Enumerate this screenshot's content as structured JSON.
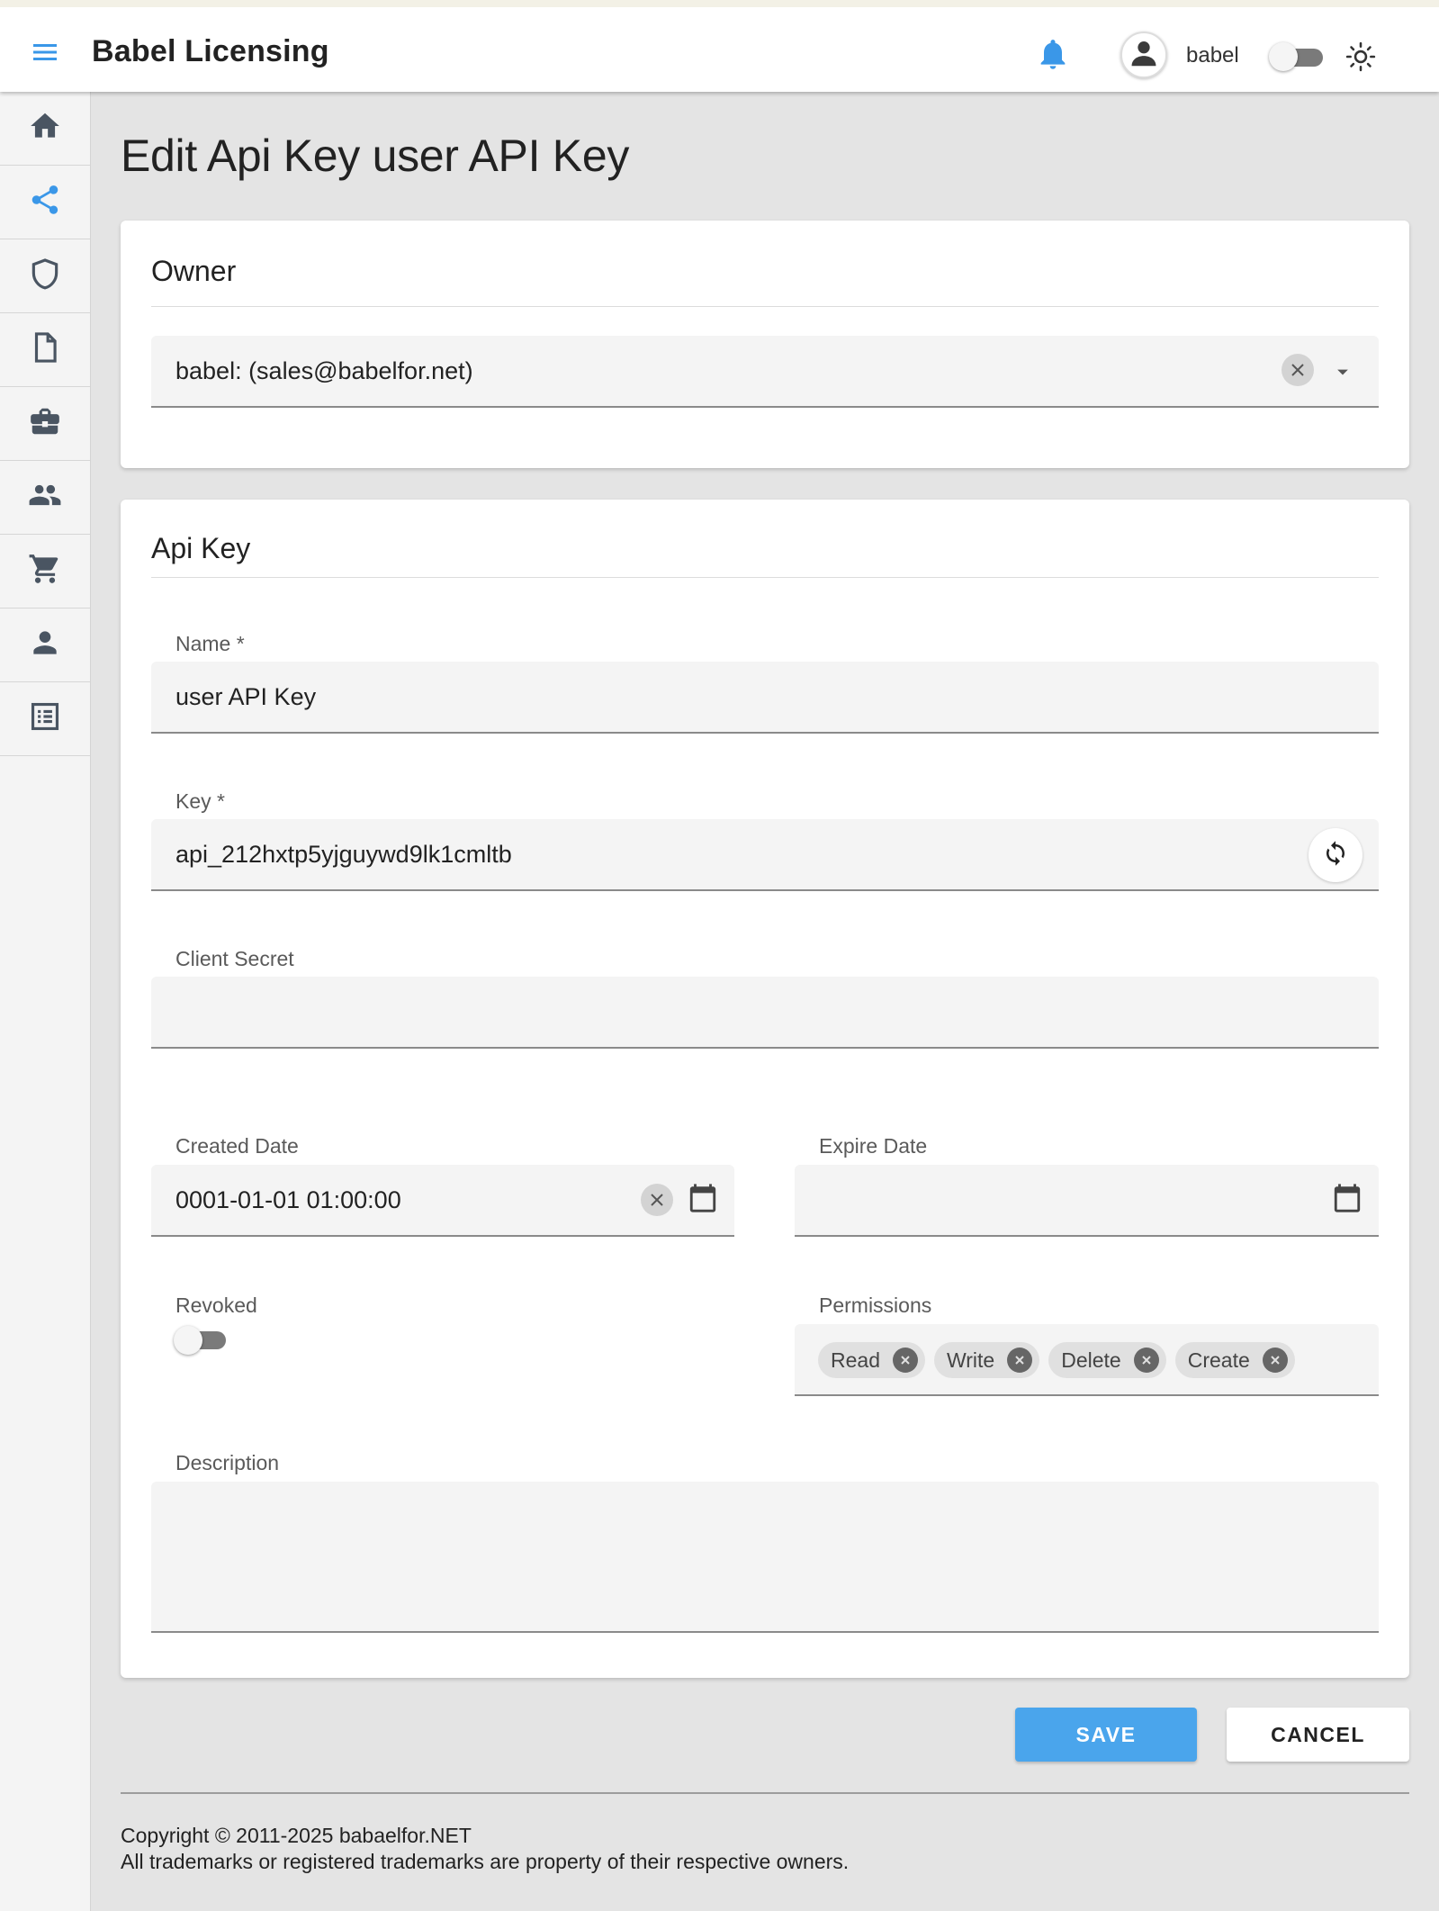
{
  "header": {
    "title": "Babel Licensing",
    "username": "babel",
    "icons": {
      "menu": "menu-icon",
      "notifications": "bell-icon",
      "user": "account-circle-icon",
      "theme": "sun-icon"
    },
    "accent_color": "#3a97e8"
  },
  "sidebar": {
    "items": [
      {
        "icon": "home-icon",
        "active": false
      },
      {
        "icon": "share-icon",
        "active": true
      },
      {
        "icon": "shield-icon",
        "active": false
      },
      {
        "icon": "document-icon",
        "active": false
      },
      {
        "icon": "briefcase-icon",
        "active": false
      },
      {
        "icon": "group-icon",
        "active": false
      },
      {
        "icon": "cart-icon",
        "active": false
      },
      {
        "icon": "person-icon",
        "active": false
      },
      {
        "icon": "list-icon",
        "active": false
      }
    ]
  },
  "page": {
    "title": "Edit Api Key user API Key"
  },
  "owner_card": {
    "title": "Owner",
    "owner_value": "babel: (sales@babelfor.net)"
  },
  "apikey_card": {
    "title": "Api Key",
    "name": {
      "label": "Name *",
      "value": "user API Key"
    },
    "key": {
      "label": "Key *",
      "value": "api_212hxtp5yjguywd9lk1cmltb"
    },
    "client_secret": {
      "label": "Client Secret",
      "value": ""
    },
    "created_date": {
      "label": "Created Date",
      "value": "0001-01-01 01:00:00"
    },
    "expire_date": {
      "label": "Expire Date",
      "value": ""
    },
    "revoked": {
      "label": "Revoked",
      "checked": false
    },
    "permissions": {
      "label": "Permissions",
      "chips": [
        "Read",
        "Write",
        "Delete",
        "Create"
      ]
    },
    "description": {
      "label": "Description",
      "value": ""
    }
  },
  "actions": {
    "save_label": "SAVE",
    "cancel_label": "CANCEL",
    "save_color": "#4aa5ec"
  },
  "footer": {
    "copyright": "Copyright © 2011-2025 babaelfor.NET",
    "trademark": "All trademarks or registered trademarks are property of their respective owners."
  }
}
